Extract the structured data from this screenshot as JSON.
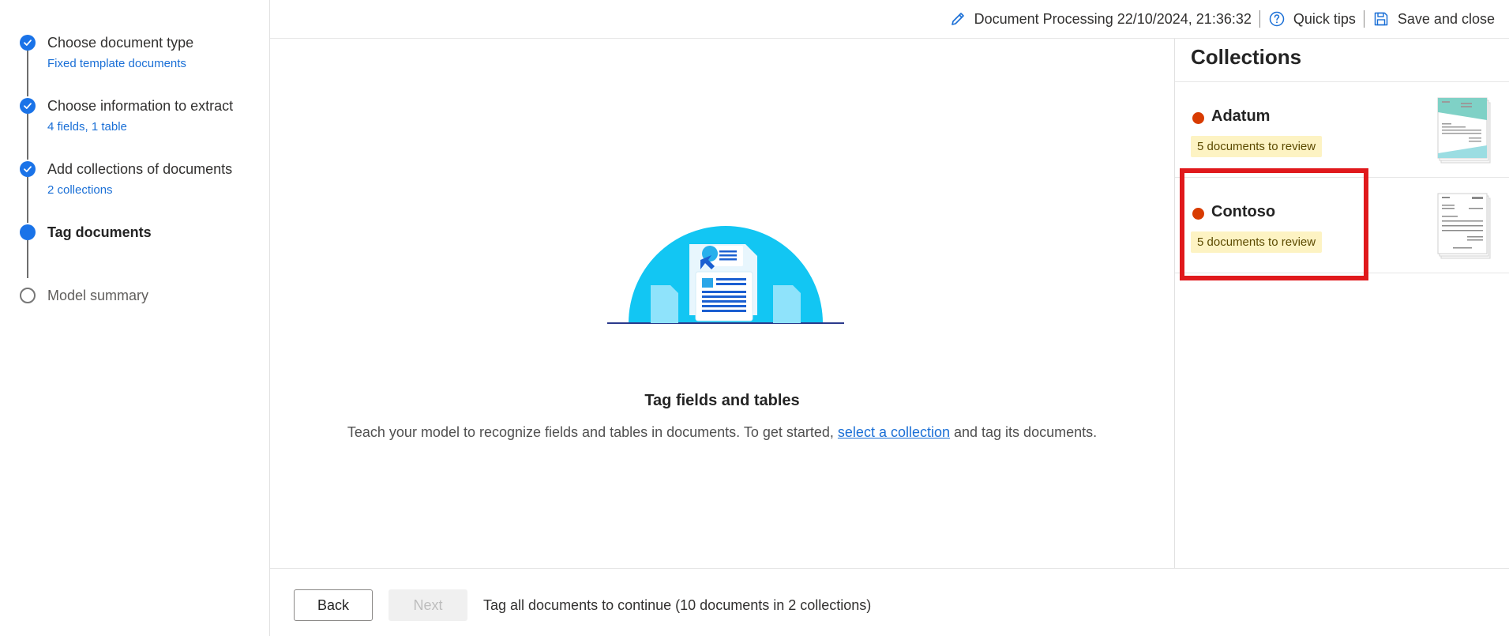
{
  "sidebar": {
    "steps": [
      {
        "title": "Choose document type",
        "sub": "Fixed template documents",
        "state": "done"
      },
      {
        "title": "Choose information to extract",
        "sub": "4 fields, 1 table",
        "state": "done"
      },
      {
        "title": "Add collections of documents",
        "sub": "2 collections",
        "state": "done"
      },
      {
        "title": "Tag documents",
        "sub": "",
        "state": "current"
      },
      {
        "title": "Model summary",
        "sub": "",
        "state": "todo"
      }
    ]
  },
  "topbar": {
    "doc_label": "Document Processing 22/10/2024, 21:36:32",
    "quick_tips": "Quick tips",
    "save_close": "Save and close"
  },
  "main": {
    "title": "Tag fields and tables",
    "desc_before": "Teach your model to recognize fields and tables in documents. To get started, ",
    "desc_link": "select a collection",
    "desc_after": " and tag its documents."
  },
  "collections": {
    "title": "Collections",
    "items": [
      {
        "name": "Adatum",
        "badge": "5 documents to review",
        "status_color": "#d83b01"
      },
      {
        "name": "Contoso",
        "badge": "5 documents to review",
        "status_color": "#d83b01"
      }
    ]
  },
  "footer": {
    "back": "Back",
    "next": "Next",
    "message": "Tag all documents to continue (10 documents in 2 collections)"
  },
  "colors": {
    "accent": "#1a73e8",
    "link": "#1a6fd6",
    "status": "#d83b01",
    "highlight": "#e0191c"
  }
}
